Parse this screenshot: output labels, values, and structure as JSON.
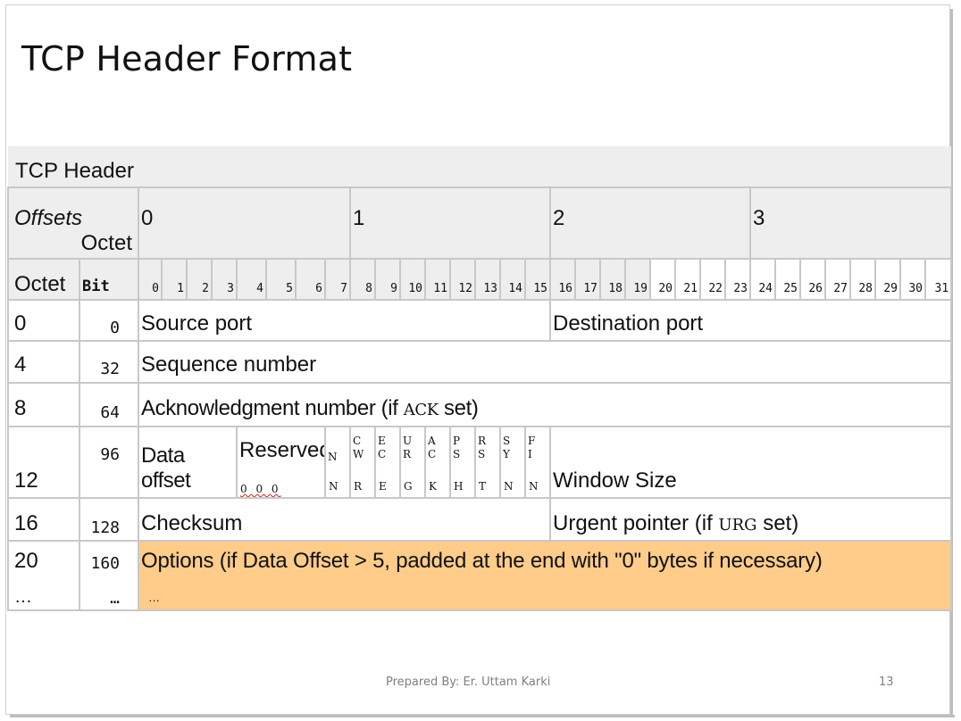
{
  "slide": {
    "title": "TCP Header Format",
    "footer": "Prepared By: Er. Uttam Karki",
    "page_number": "13"
  },
  "table": {
    "caption": "TCP Header",
    "offsets_label": "Offsets",
    "octet_label": "Octet",
    "octet_header_numbers": [
      "0",
      "1",
      "2",
      "3"
    ],
    "octet_row_label": "Octet",
    "bit_label": "Bit",
    "bit_numbers": [
      "0",
      "1",
      "2",
      "3",
      "4",
      "5",
      "6",
      "7",
      "8",
      "9",
      "10",
      "11",
      "12",
      "13",
      "14",
      "15",
      "16",
      "17",
      "18",
      "19",
      "20",
      "21",
      "22",
      "23",
      "24",
      "25",
      "26",
      "27",
      "28",
      "29",
      "30",
      "31"
    ],
    "rows": [
      {
        "octet": "0",
        "bit": "0",
        "field_a": "Source port",
        "field_b": "Destination port"
      },
      {
        "octet": "4",
        "bit": "32",
        "field": "Sequence number"
      },
      {
        "octet": "8",
        "bit": "64",
        "field_pre": "Acknowledgment number (if ",
        "field_code": "ACK",
        "field_post": " set)"
      },
      {
        "octet": "12",
        "bit": "96",
        "data_offset": "Data offset",
        "reserved": "Reserved",
        "reserved_bits": "0 0 0",
        "window_size": "Window Size"
      },
      {
        "octet": "16",
        "bit": "128",
        "field_a": "Checksum",
        "field_b_pre": "Urgent pointer (if ",
        "field_b_code": "URG",
        "field_b_post": " set)"
      },
      {
        "octet": "20",
        "bit": "160",
        "options": "Options (if Data Offset > 5, padded at the end with \"0\" bytes if necessary)"
      }
    ],
    "flags": [
      {
        "top": "",
        "bottom": "N",
        "top_side": "N"
      },
      {
        "top": "C\nW",
        "bottom": "R"
      },
      {
        "top": "E\nC",
        "bottom": "E"
      },
      {
        "top": "U\nR",
        "bottom": "G"
      },
      {
        "top": "A\nC",
        "bottom": "K"
      },
      {
        "top": "P\nS",
        "bottom": "H"
      },
      {
        "top": "R\nS",
        "bottom": "T"
      },
      {
        "top": "S\nY",
        "bottom": "N"
      },
      {
        "top": "F\nI",
        "bottom": "N"
      }
    ],
    "ellipsis_octet": "…",
    "ellipsis_bit": "…",
    "ellipsis_field": "…"
  },
  "colors": {
    "options_bg": "#ffcc8a",
    "header_bg": "#eeeeee",
    "grid": "#c8c8c8"
  }
}
